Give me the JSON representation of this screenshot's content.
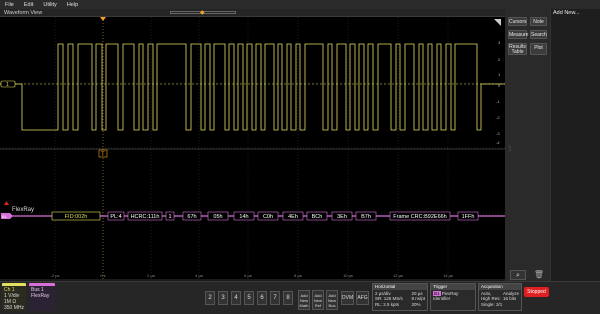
{
  "menu": [
    "File",
    "Edit",
    "Utility",
    "Help"
  ],
  "view_title": "Waveform View",
  "channel_marker": "1",
  "bus_marker": "B1",
  "bus_name": "FlexRay",
  "decode": [
    "FID:002h",
    "PL:4",
    "HCRC:111h",
    "1",
    "67h",
    "05h",
    "14h",
    "C0h",
    "4Eh",
    "BCh",
    "3Eh",
    "B7h",
    "Frame CRC:B92E66h",
    "1FFh"
  ],
  "time_labels": [
    "-2 µs",
    "0 s",
    "2 µs",
    "4 µs",
    "6 µs",
    "8 µs",
    "10 µs",
    "12 µs",
    "14 µs"
  ],
  "scale_labels": [
    "3",
    "2",
    "1",
    "0",
    "-1",
    "-2",
    "-3",
    "-4"
  ],
  "right_panel": {
    "add_new": "Add New...",
    "buttons": [
      "Cursors",
      "Note",
      "Measure",
      "Search",
      "Results Table",
      "Plot"
    ]
  },
  "ch1": {
    "label": "Ch 1",
    "lines": [
      "1 V/div",
      "1M Ω",
      "350 MHz"
    ]
  },
  "bus1": {
    "label": "Bus 1",
    "value": "FlexRay"
  },
  "channel_buttons": [
    "2",
    "3",
    "4",
    "5",
    "6",
    "7",
    "8"
  ],
  "math_buttons": [
    "Add New Math",
    "Add New Ref",
    "Add New Bus"
  ],
  "dvm": "DVM",
  "afg": "AFG",
  "horizontal": {
    "title": "Horizontal",
    "lines": [
      "2 µs/div",
      "SR: 125 MS/s",
      "RL: 2.5 kpts"
    ],
    "lines_right": [
      "20 µs",
      "8 ns/pt",
      "20%"
    ]
  },
  "trigger": {
    "title": "Trigger",
    "lines": [
      "FlexRay",
      "Identifier"
    ]
  },
  "acquisition": {
    "title": "Acquisition",
    "lines": [
      "Auto,",
      "High Res:",
      "Single: 3/1"
    ],
    "lines_right": [
      "Analyze",
      "16 bits",
      ""
    ]
  },
  "stop": "Stopped",
  "colors": {
    "ch1": "#e3df5f",
    "bus": "#d86fd8",
    "trigger": "#f0a020"
  }
}
